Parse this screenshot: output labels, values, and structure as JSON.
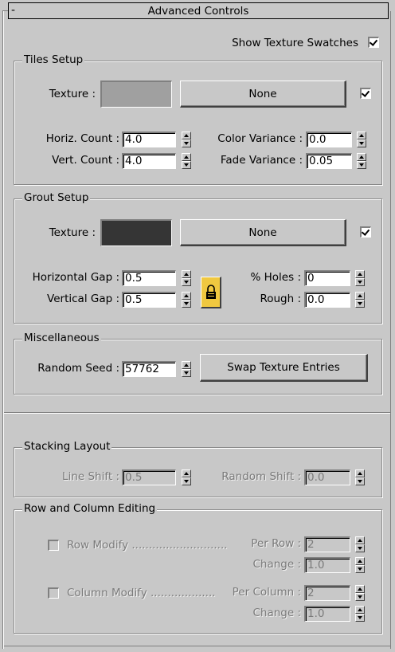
{
  "rollout": {
    "title": "Advanced Controls",
    "collapse_symbol": "-"
  },
  "show_texture_swatches": {
    "label": "Show Texture Swatches",
    "checked": true
  },
  "tiles_setup": {
    "title": "Tiles Setup",
    "texture_label": "Texture :",
    "texture_color": "#a0a0a0",
    "map_button": "None",
    "map_enabled": true,
    "horiz_count_label": "Horiz. Count :",
    "horiz_count": "4.0",
    "vert_count_label": "Vert. Count :",
    "vert_count": "4.0",
    "color_variance_label": "Color Variance :",
    "color_variance": "0.0",
    "fade_variance_label": "Fade Variance :",
    "fade_variance": "0.05"
  },
  "grout_setup": {
    "title": "Grout Setup",
    "texture_label": "Texture :",
    "texture_color": "#353535",
    "map_button": "None",
    "map_enabled": true,
    "horizontal_gap_label": "Horizontal Gap :",
    "horizontal_gap": "0.5",
    "vertical_gap_label": "Vertical Gap :",
    "vertical_gap": "0.5",
    "holes_label": "% Holes :",
    "holes": "0",
    "rough_label": "Rough :",
    "rough": "0.0",
    "lock_icon": "lock-icon"
  },
  "miscellaneous": {
    "title": "Miscellaneous",
    "random_seed_label": "Random Seed :",
    "random_seed": "57762",
    "swap_button": "Swap Texture Entries"
  },
  "stacking_layout": {
    "title": "Stacking Layout",
    "line_shift_label": "Line Shift :",
    "line_shift": "0.5",
    "random_shift_label": "Random Shift :",
    "random_shift": "0.0"
  },
  "row_column_editing": {
    "title": "Row and Column Editing",
    "row_modify_label": "Row Modify ............................",
    "row_modify_checked": false,
    "per_row_label": "Per Row :",
    "per_row": "2",
    "row_change_label": "Change :",
    "row_change": "1.0",
    "column_modify_label": "Column Modify ...................",
    "column_modify_checked": false,
    "per_column_label": "Per Column :",
    "per_column": "2",
    "column_change_label": "Change :",
    "column_change": "1.0"
  }
}
